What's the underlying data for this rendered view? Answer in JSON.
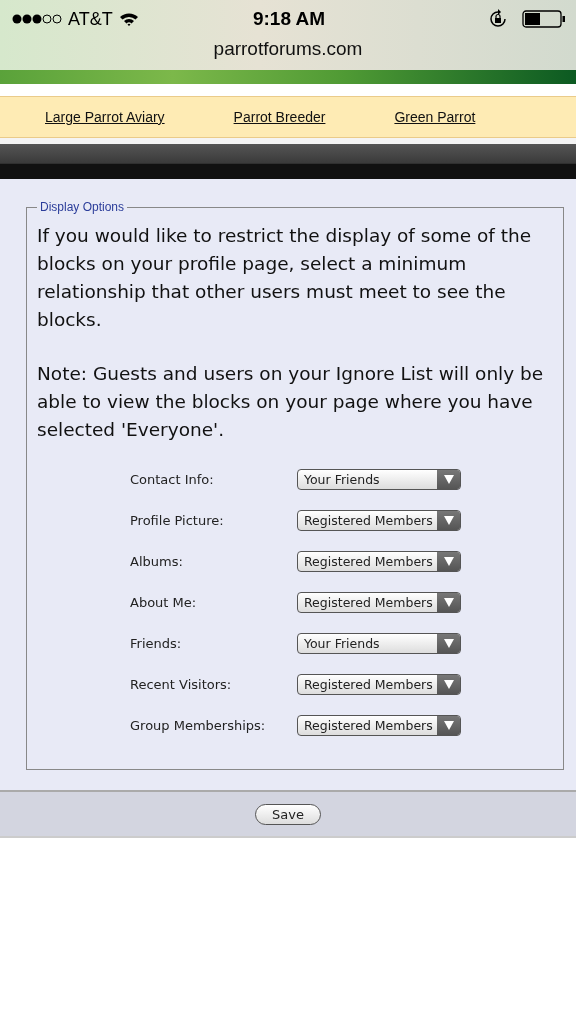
{
  "status_bar": {
    "carrier": "AT&T",
    "time": "9:18 AM",
    "url": "parrotforums.com"
  },
  "links": [
    "Large Parrot Aviary",
    "Parrot Breeder",
    "Green Parrot"
  ],
  "display_options": {
    "legend": "Display Options",
    "intro": "If you would like to restrict the display of some of the blocks on your profile page, select a minimum relationship that other users must meet to see the blocks.",
    "note": "Note: Guests and users on your Ignore List will only be able to view the blocks on your page where you have selected 'Everyone'.",
    "rows": [
      {
        "label": "Contact Info:",
        "value": "Your Friends"
      },
      {
        "label": "Profile Picture:",
        "value": "Registered Members"
      },
      {
        "label": "Albums:",
        "value": "Registered Members"
      },
      {
        "label": "About Me:",
        "value": "Registered Members"
      },
      {
        "label": "Friends:",
        "value": "Your Friends"
      },
      {
        "label": "Recent Visitors:",
        "value": "Registered Members"
      },
      {
        "label": "Group Memberships:",
        "value": "Registered Members"
      }
    ]
  },
  "buttons": [
    "Save"
  ]
}
